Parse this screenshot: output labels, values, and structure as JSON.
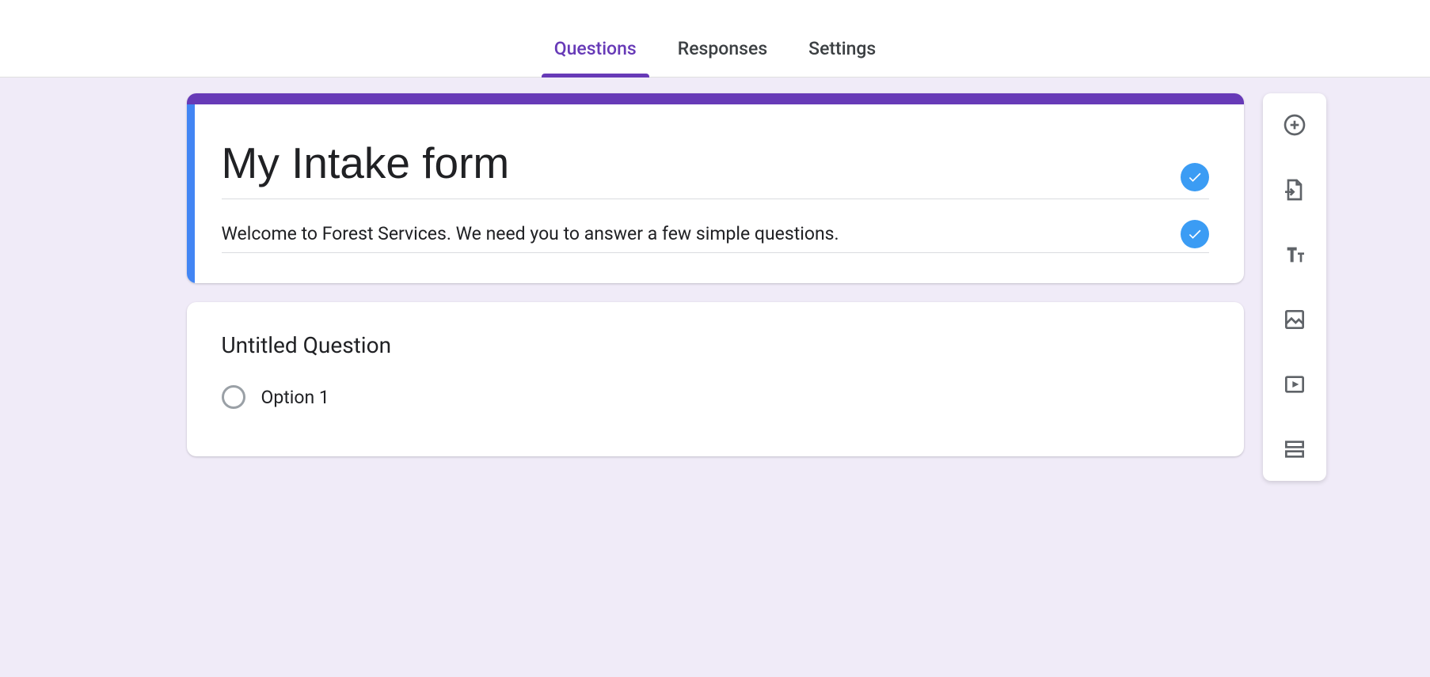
{
  "tabs": {
    "questions": "Questions",
    "responses": "Responses",
    "settings": "Settings",
    "active": "questions"
  },
  "header": {
    "title": "My Intake form",
    "description": "Welcome to Forest Services. We need you to answer a few simple questions."
  },
  "question": {
    "title": "Untitled Question",
    "options": [
      {
        "label": "Option 1"
      }
    ]
  },
  "toolbar": {
    "add_question": "Add question",
    "import_questions": "Import questions",
    "add_title": "Add title and description",
    "add_image": "Add image",
    "add_video": "Add video",
    "add_section": "Add section"
  },
  "colors": {
    "accent": "#673ab7",
    "selection": "#4285f4",
    "canvas": "#f0ebf8",
    "badge": "#3b9cf4"
  }
}
